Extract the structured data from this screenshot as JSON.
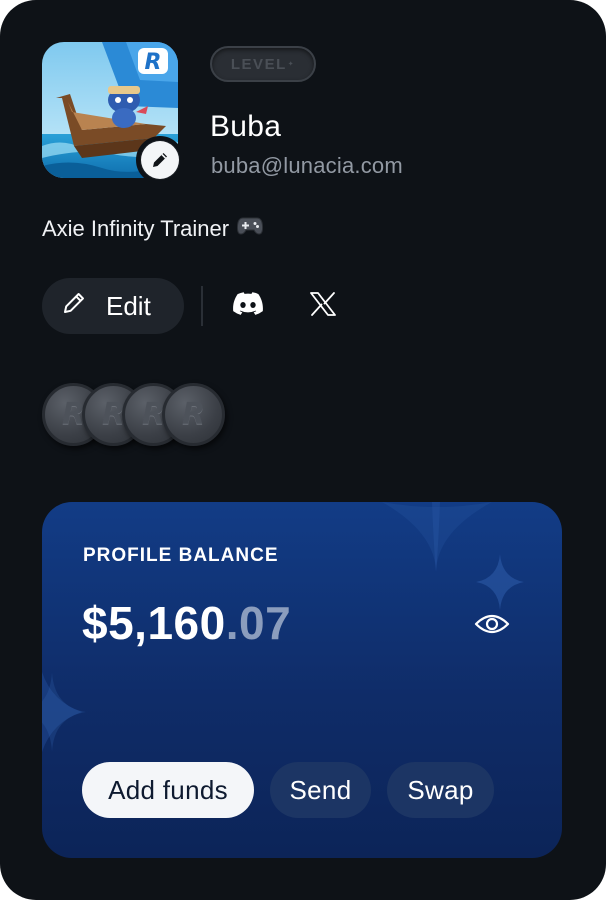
{
  "profile": {
    "level_label": "LEVEL",
    "name": "Buba",
    "email": "buba@lunacia.com",
    "bio": "Axie Infinity Trainer",
    "avatar_icon": "avatar-boat-image"
  },
  "actions": {
    "edit_label": "Edit",
    "social": [
      "discord-icon",
      "x-icon"
    ]
  },
  "coins": [
    {
      "letter": "R"
    },
    {
      "letter": "R"
    },
    {
      "letter": "R"
    },
    {
      "letter": "R"
    }
  ],
  "balance": {
    "label": "PROFILE BALANCE",
    "amount_whole": "$5,160",
    "amount_cents": ".07",
    "buttons": {
      "add_funds": "Add funds",
      "send": "Send",
      "swap": "Swap"
    }
  },
  "colors": {
    "background": "#0e1217",
    "card_top": "#123c86",
    "card_bottom": "#0c2458",
    "accent_white": "#f4f6f9"
  }
}
